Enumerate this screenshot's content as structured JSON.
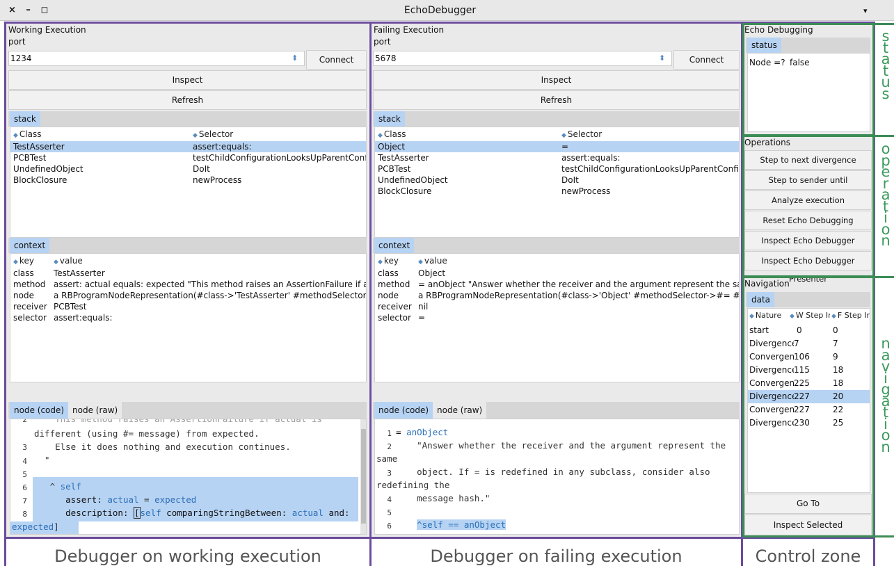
{
  "window": {
    "title": "EchoDebugger",
    "controls": "× – ◻",
    "menu_icon": "▾"
  },
  "working": {
    "heading": "Working Execution",
    "port_label": "port",
    "port_value": "1234",
    "spin_icon": "⬍",
    "connect": "Connect",
    "inspect": "Inspect",
    "refresh": "Refresh",
    "stack_tab": "stack",
    "col_class": "Class",
    "col_selector": "Selector",
    "stack": [
      [
        "TestAsserter",
        "assert:equals:"
      ],
      [
        "PCBTest",
        "testChildConfigurationLooksUpParentConfigurat"
      ],
      [
        "UndefinedObject",
        "DoIt"
      ],
      [
        "BlockClosure",
        "newProcess"
      ]
    ],
    "context_tab": "context",
    "col_key": "key",
    "col_value": "value",
    "context": [
      [
        "class",
        "TestAsserter"
      ],
      [
        "method",
        "assert: actual equals: expected  \"This method raises an AssertionFailure if actual is diffe"
      ],
      [
        "node",
        "a RBProgramNodeRepresentation(#class->'TestAsserter' #methodSelector->#assert:eq"
      ],
      [
        "receiver",
        "PCBTest"
      ],
      [
        "selector",
        "assert:equals:"
      ]
    ],
    "tab_code": "node (code)",
    "tab_raw": "node (raw)",
    "code": {
      "l0": "    This method raises an AssertionFailure if actual is",
      "l0b": "different (using #= message) from expected.",
      "l3": "    Else it does nothing and execution continues.",
      "l4": "  \"",
      "l6": "self",
      "l7a": "assert: ",
      "l7b": "actual",
      "l7c": " = ",
      "l7d": "expected",
      "l8a": "description: ",
      "l8b": "[",
      "l8c": "self",
      "l8d": " comparingStringBetween: ",
      "l8e": "actual",
      "l8f": " and:",
      "l9": "expected",
      "l9b": "]"
    },
    "caption": "Debugger on working execution"
  },
  "failing": {
    "heading": "Failing Execution",
    "port_label": "port",
    "port_value": "5678",
    "spin_icon": "⬍",
    "connect": "Connect",
    "inspect": "Inspect",
    "refresh": "Refresh",
    "stack_tab": "stack",
    "col_class": "Class",
    "col_selector": "Selector",
    "stack": [
      [
        "Object",
        "="
      ],
      [
        "TestAsserter",
        "assert:equals:"
      ],
      [
        "PCBTest",
        "testChildConfigurationLooksUpParentConfigurati"
      ],
      [
        "UndefinedObject",
        "DoIt"
      ],
      [
        "BlockClosure",
        "newProcess"
      ]
    ],
    "context_tab": "context",
    "col_key": "key",
    "col_value": "value",
    "context": [
      [
        "class",
        "Object"
      ],
      [
        "method",
        "= anObject  \"Answer whether the receiver and the argument represent the same  object."
      ],
      [
        "node",
        "a RBProgramNodeRepresentation(#class->'Object' #methodSelector->#= #methodSourc"
      ],
      [
        "receiver",
        "nil"
      ],
      [
        "selector",
        "="
      ]
    ],
    "tab_code": "node (code)",
    "tab_raw": "node (raw)",
    "code": {
      "l1a": "= ",
      "l1b": "anObject",
      "l2": "    \"Answer whether the receiver and the argument represent the",
      "l2b": "same",
      "l3": "    object. If = is redefined in any subclass, consider also",
      "l3b": "redefining the",
      "l4": "    message hash.\"",
      "l6a": "^",
      "l6b": "self == anObject"
    },
    "caption": "Debugger on failing execution"
  },
  "control": {
    "echo_heading": "Echo Debugging",
    "status_tab": "status",
    "node_label": "Node =?",
    "node_value": "false",
    "ops_heading": "Operations",
    "ops": [
      "Step to next divergence",
      "Step to sender until convergence",
      "Analyze execution",
      "Reset Echo Debugging",
      "Inspect Echo Debugger",
      "Inspect Echo Debugger Presenter"
    ],
    "nav_heading": "Navigation",
    "data_tab": "data",
    "col_nature": "Nature",
    "col_w": "W Step Ir",
    "col_f": "F Step In",
    "nav_rows": [
      [
        "start",
        "0",
        "0"
      ],
      [
        "Divergence",
        "7",
        "7"
      ],
      [
        "Convergen",
        "106",
        "9"
      ],
      [
        "Divergence",
        "115",
        "18"
      ],
      [
        "Convergen",
        "225",
        "18"
      ],
      [
        "Divergence",
        "227",
        "20"
      ],
      [
        "Convergen",
        "227",
        "22"
      ],
      [
        "Divergence",
        "230",
        "25"
      ]
    ],
    "goto": "Go To",
    "inspect_selected": "Inspect Selected",
    "caption": "Control zone"
  },
  "side_labels": {
    "status": "status",
    "operation": "operation",
    "navigation": "navigation"
  }
}
